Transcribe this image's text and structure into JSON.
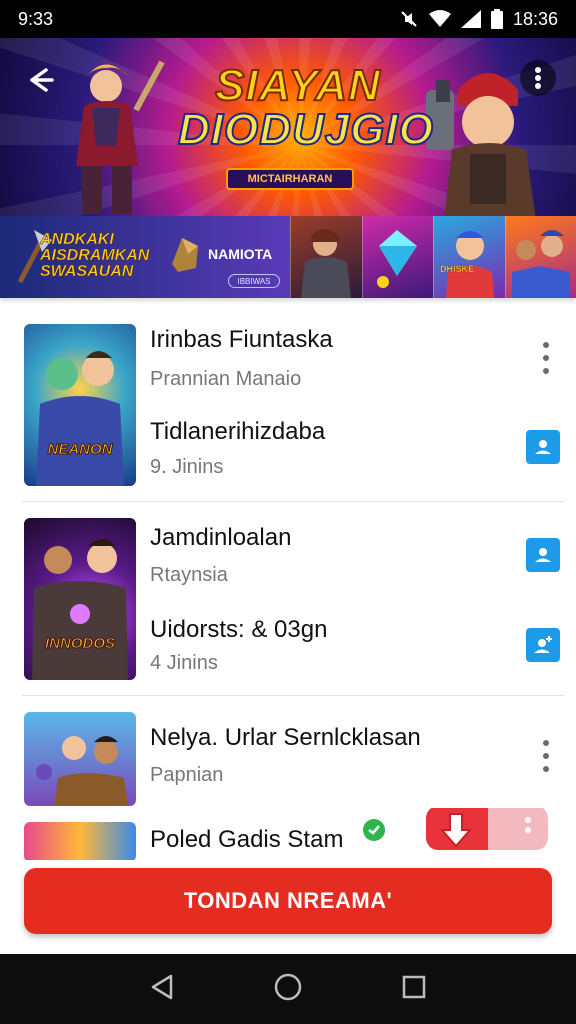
{
  "status_bar": {
    "time": "9:33",
    "right_time": "18:36"
  },
  "hero": {
    "title_line1": "SIAYAN",
    "title_line2": "DIODUJGIO",
    "subtitle": "MICTAIRHARAN"
  },
  "promo": {
    "title": "ANDKAKI AISDRAMKAN SWASAUAN",
    "brand": "NAMIOTA",
    "button": "IBBIWAS",
    "tiles": [
      {
        "label": ""
      },
      {
        "label": ""
      },
      {
        "label": "DHISKE"
      },
      {
        "label": ""
      }
    ]
  },
  "list": [
    {
      "title": "Irinbas Fiuntaska",
      "subtitle": "Prannian Manaio",
      "detail": "Tidlanerihizdaba",
      "meta": "9. Jinins",
      "thumb_label": "NEANON"
    },
    {
      "title": "Jamdinloalan",
      "subtitle": "Rtaynsia",
      "detail": "Uidorsts: & 03gn",
      "meta": "4 Jinins",
      "thumb_label": "INNODOS"
    },
    {
      "title": "Nelya. Urlar Sernlcklasan",
      "subtitle": "Papnian",
      "thumb_label": ""
    }
  ],
  "partial_row": {
    "title": "Poled Gadis Stam"
  },
  "cta": {
    "label": "TONDAN NREAMA'"
  },
  "colors": {
    "accent": "#e42d20",
    "blue_icon": "#1e9be8"
  }
}
